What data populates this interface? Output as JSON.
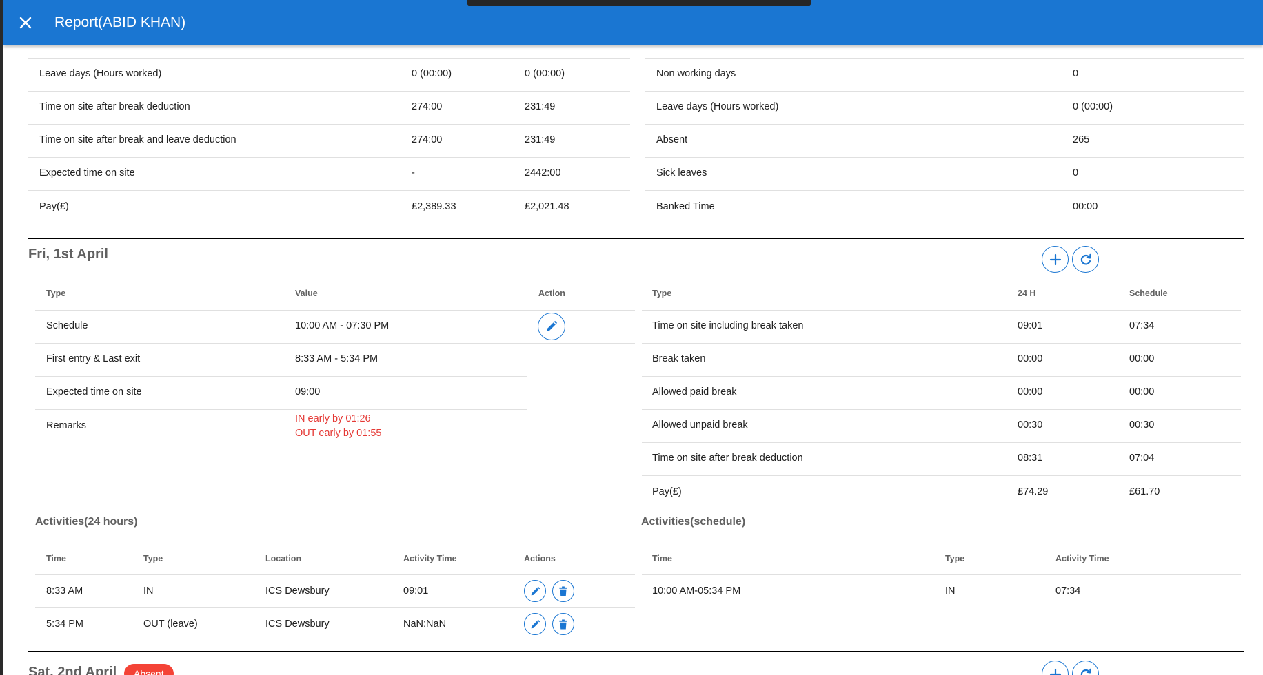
{
  "header": {
    "title": "Report(ABID KHAN)"
  },
  "summary": {
    "left_rows": [
      {
        "label": "Leave days (Hours worked)",
        "v1": "0 (00:00)",
        "v2": "0 (00:00)"
      },
      {
        "label": "Time on site after break deduction",
        "v1": "274:00",
        "v2": "231:49"
      },
      {
        "label": "Time on site after break and leave deduction",
        "v1": "274:00",
        "v2": "231:49"
      },
      {
        "label": "Expected time on site",
        "v1": "-",
        "v2": "2442:00"
      },
      {
        "label": "Pay(£)",
        "v1": "£2,389.33",
        "v2": "£2,021.48"
      }
    ],
    "right_rows": [
      {
        "label": "Non working days",
        "value": "0"
      },
      {
        "label": "Leave days (Hours worked)",
        "value": "0 (00:00)"
      },
      {
        "label": "Absent",
        "value": "265"
      },
      {
        "label": "Sick leaves",
        "value": "0"
      },
      {
        "label": "Banked Time",
        "value": "00:00"
      }
    ]
  },
  "day1": {
    "title": "Fri, 1st April",
    "details_headers": {
      "type": "Type",
      "value": "Value",
      "action": "Action"
    },
    "details": [
      {
        "type": "Schedule",
        "value": "10:00 AM - 07:30 PM"
      },
      {
        "type": "First entry & Last exit",
        "value": "8:33 AM - 5:34 PM"
      },
      {
        "type": "Expected time on site",
        "value": "09:00"
      },
      {
        "type": "Remarks",
        "value": "",
        "remarks": [
          "IN early by 01:26",
          "OUT early by 01:55"
        ]
      }
    ],
    "hours_headers": {
      "type": "Type",
      "h24": "24 H",
      "schedule": "Schedule"
    },
    "hours": [
      {
        "type": "Time on site including break taken",
        "h24": "09:01",
        "schedule": "07:34"
      },
      {
        "type": "Break taken",
        "h24": "00:00",
        "schedule": "00:00"
      },
      {
        "type": "Allowed paid break",
        "h24": "00:00",
        "schedule": "00:00"
      },
      {
        "type": "Allowed unpaid break",
        "h24": "00:30",
        "schedule": "00:30"
      },
      {
        "type": "Time on site after break deduction",
        "h24": "08:31",
        "schedule": "07:04"
      },
      {
        "type": "Pay(£)",
        "h24": "£74.29",
        "schedule": "£61.70"
      }
    ],
    "activities24": {
      "title": "Activities(24 hours)",
      "headers": {
        "time": "Time",
        "type": "Type",
        "location": "Location",
        "activity_time": "Activity Time",
        "actions": "Actions"
      },
      "rows": [
        {
          "time": "8:33 AM",
          "type": "IN",
          "location": "ICS Dewsbury",
          "activity_time": "09:01"
        },
        {
          "time": "5:34 PM",
          "type": "OUT (leave)",
          "location": "ICS Dewsbury",
          "activity_time": "NaN:NaN"
        }
      ]
    },
    "activities_schedule": {
      "title": "Activities(schedule)",
      "headers": {
        "time": "Time",
        "type": "Type",
        "activity_time": "Activity Time"
      },
      "rows": [
        {
          "time": "10:00 AM-05:34 PM",
          "type": "IN",
          "activity_time": "07:34"
        }
      ]
    }
  },
  "day2": {
    "title": "Sat, 2nd April",
    "badge": "Absent"
  },
  "colors": {
    "primary": "#1a76d2",
    "remark_red": "#e53935",
    "badge_red": "#f44336"
  },
  "icons": [
    "close-icon",
    "plus-icon",
    "refresh-icon",
    "pencil-icon",
    "trash-icon"
  ]
}
